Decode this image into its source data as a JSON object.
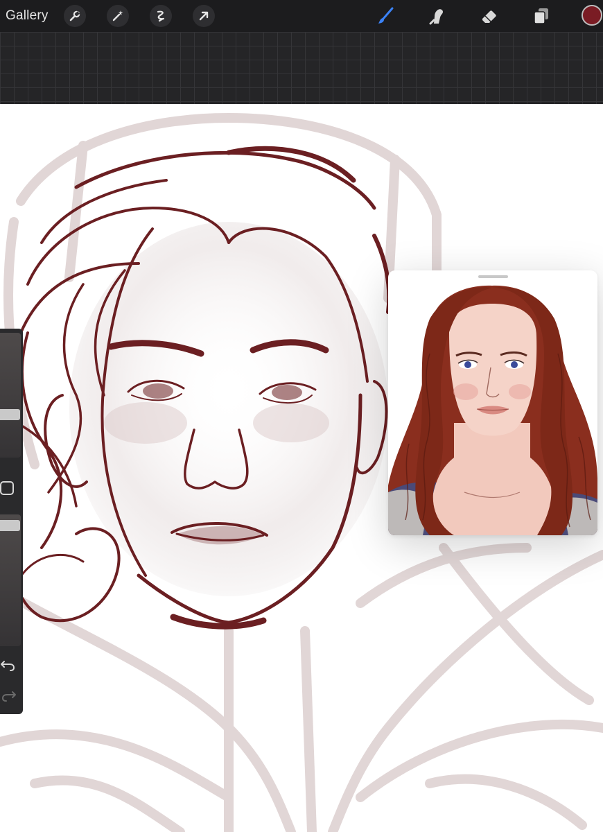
{
  "toolbar": {
    "gallery_label": "Gallery",
    "left_tools": [
      "wrench-icon",
      "magic-wand-icon",
      "selection-icon",
      "transform-arrow-icon"
    ],
    "right_tools": [
      "brush-icon",
      "smudge-icon",
      "eraser-icon",
      "layers-icon"
    ],
    "active_tool": "brush-icon",
    "current_color": "#7a1c24",
    "accent_color": "#3b82f6"
  },
  "sidebar": {
    "brush_size_level": 0.75,
    "opacity_level": 0.08
  },
  "colors": {
    "sketch_stroke": "#6b1f22",
    "faded_sketch": "#d9cccc",
    "hair_reference": "#8a2e1e"
  }
}
